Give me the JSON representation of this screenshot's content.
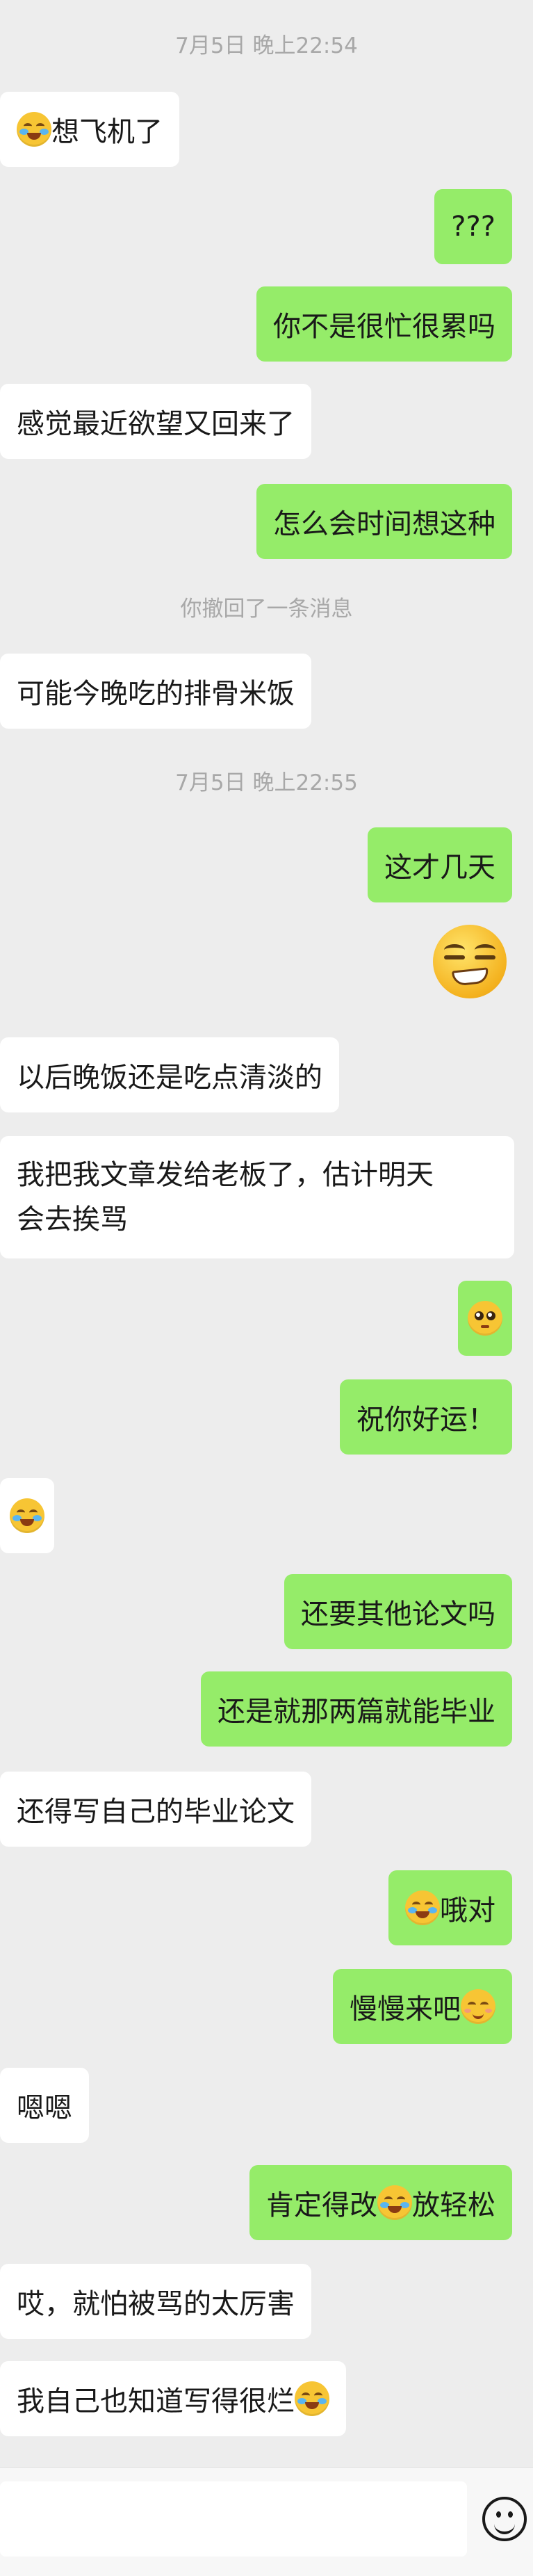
{
  "timestamps": [
    "7月5日 晚上22:54",
    "7月5日 晚上22:55"
  ],
  "system_notice": "你撤回了一条消息",
  "messages": [
    {
      "text": "想飞机了",
      "emoji": "laugh-cry-emoji"
    },
    {
      "text": "???"
    },
    {
      "text": "你不是很忙很累吗"
    },
    {
      "text": "感觉最近欲望又回来了"
    },
    {
      "text": "怎么会时间想这种"
    },
    {
      "text": "可能今晚吃的排骨米饭"
    },
    {
      "text": "这才几天"
    },
    {
      "sticker": "smirk-sticker"
    },
    {
      "text": "以后晚饭还是吃点清淡的"
    },
    {
      "line1": "我把我文章发给老板了，估计明天",
      "line2": "会去挨骂"
    },
    {
      "emoji": "pleading-emoji"
    },
    {
      "text": "祝你好运！"
    },
    {
      "emoji": "laugh-cry-emoji"
    },
    {
      "text": "还要其他论文吗"
    },
    {
      "text": "还是就那两篇就能毕业"
    },
    {
      "text": "还得写自己的毕业论文"
    },
    {
      "text": "哦对",
      "emoji": "laugh-cry-emoji"
    },
    {
      "text": "慢慢来吧",
      "emoji": "smile-emoji"
    },
    {
      "text": "嗯嗯"
    },
    {
      "text_before": "肯定得改",
      "text_after": "放轻松",
      "emoji": "laugh-cry-emoji"
    },
    {
      "text": "哎，就怕被骂的太厉害"
    },
    {
      "text": "我自己也知道写得很烂",
      "emoji": "laugh-cry-emoji"
    }
  ],
  "input_bar": {
    "emoji_button_icon": "emoji-face-icon"
  },
  "colors": {
    "background": "#ededed",
    "outgoing_bubble": "#95ec69",
    "incoming_bubble": "#ffffff",
    "timestamp_text": "#a8a8a8"
  }
}
